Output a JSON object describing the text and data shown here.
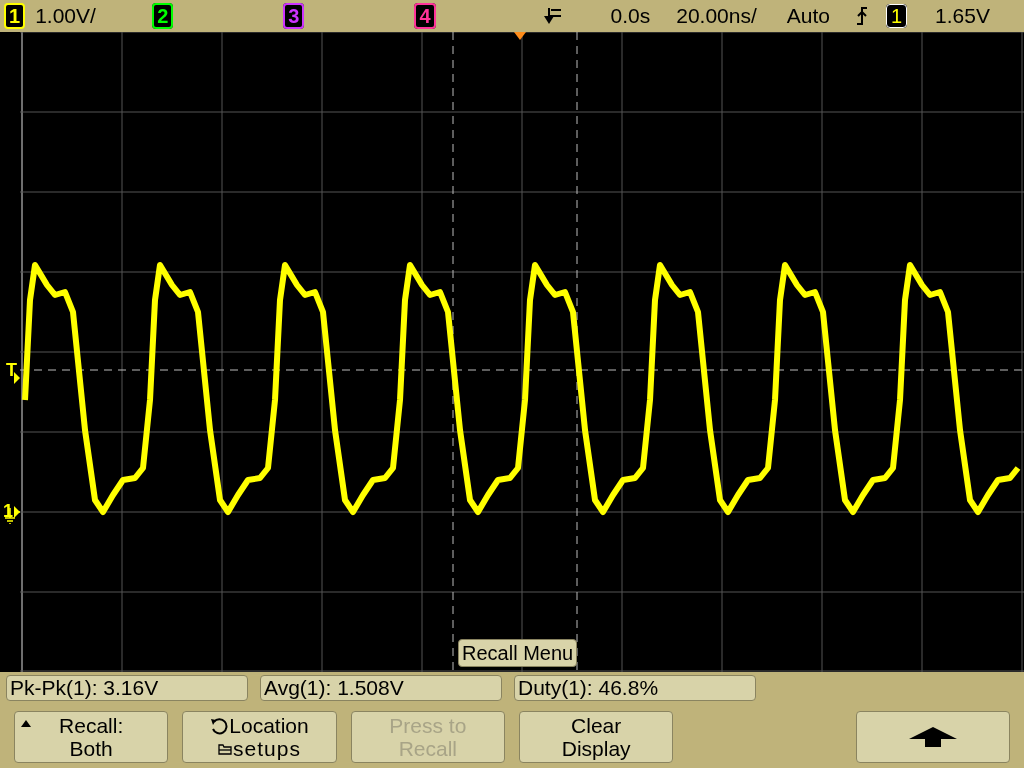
{
  "header": {
    "channels": [
      {
        "label": "1",
        "color": "#ffff00",
        "scale": "1.00V/"
      },
      {
        "label": "2",
        "color": "#00ff00"
      },
      {
        "label": "3",
        "color": "#cc33ff"
      },
      {
        "label": "4",
        "color": "#ff3399"
      }
    ],
    "time_offset": "0.0s",
    "time_scale": "20.00ns/",
    "trigger_mode": "Auto",
    "trigger_source": "1",
    "trigger_level": "1.65V"
  },
  "markers": {
    "trigger": "T",
    "ground": "1"
  },
  "popup": "Recall Menu",
  "measurements": [
    "Pk-Pk(1): 3.16V",
    "Avg(1): 1.508V",
    "Duty(1): 46.8%"
  ],
  "softkeys": [
    {
      "kind": "menu",
      "lines": [
        "Recall:",
        "Both"
      ],
      "disabled": false
    },
    {
      "kind": "location",
      "lines": [
        "Location",
        "setups"
      ],
      "disabled": false
    },
    {
      "kind": "text",
      "lines": [
        "Press to",
        "Recall"
      ],
      "disabled": true
    },
    {
      "kind": "text",
      "lines": [
        "Clear",
        "Display"
      ],
      "disabled": false
    },
    {
      "kind": "arrow",
      "disabled": false
    }
  ]
}
